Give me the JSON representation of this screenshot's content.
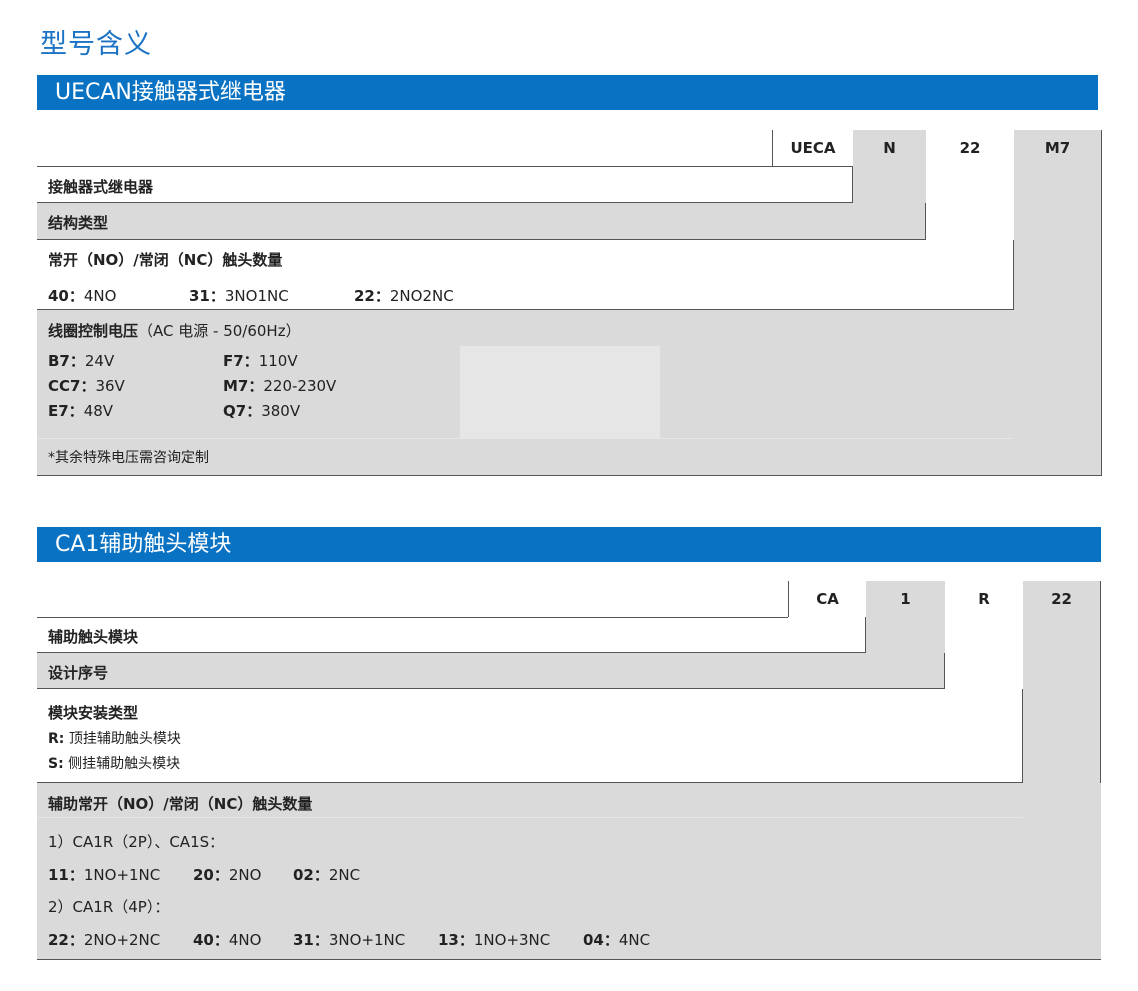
{
  "page_title": "型号含义",
  "section1": {
    "banner": "UECAN接触器式继电器",
    "codes": [
      "UECA",
      "N",
      "22",
      "M7"
    ],
    "row1_label": "接触器式继电器",
    "row2_label": "结构类型",
    "row3_label": "常开（NO）/常闭（NC）触头数量",
    "contacts": [
      {
        "k": "40：",
        "v": "4NO"
      },
      {
        "k": "31：",
        "v": "3NO1NC"
      },
      {
        "k": "22：",
        "v": "2NO2NC"
      }
    ],
    "coil_label": "线圈控制电压",
    "coil_note": "（AC 电源 - 50/60Hz）",
    "voltages_col1": [
      {
        "k": "B7：",
        "v": "24V"
      },
      {
        "k": "CC7：",
        "v": "36V"
      },
      {
        "k": "E7：",
        "v": "48V"
      }
    ],
    "voltages_col2": [
      {
        "k": "F7：",
        "v": "110V"
      },
      {
        "k": "M7：",
        "v": "220-230V"
      },
      {
        "k": "Q7：",
        "v": "380V"
      }
    ],
    "footnote": "*其余特殊电压需咨询定制"
  },
  "section2": {
    "banner": "CA1辅助触头模块",
    "codes": [
      "CA",
      "1",
      "R",
      "22"
    ],
    "row1_label": "辅助触头模块",
    "row2_label": "设计序号",
    "row3_label": "模块安装类型",
    "mount_types": [
      {
        "k": "R:",
        "v": " 顶挂辅助触头模块"
      },
      {
        "k": "S:",
        "v": " 侧挂辅助触头模块"
      }
    ],
    "row4_label": "辅助常开（NO）/常闭（NC）触头数量",
    "group1_title": "1）CA1R（2P）、CA1S：",
    "group1_items": [
      {
        "k": "11：",
        "v": "1NO+1NC"
      },
      {
        "k": "20：",
        "v": "2NO"
      },
      {
        "k": "02：",
        "v": "2NC"
      }
    ],
    "group2_title": "2）CA1R（4P）：",
    "group2_items": [
      {
        "k": "22：",
        "v": "2NO+2NC"
      },
      {
        "k": "40：",
        "v": "4NO"
      },
      {
        "k": "31：",
        "v": "3NO+1NC"
      },
      {
        "k": "13：",
        "v": "1NO+3NC"
      },
      {
        "k": "04：",
        "v": "4NC"
      }
    ]
  }
}
